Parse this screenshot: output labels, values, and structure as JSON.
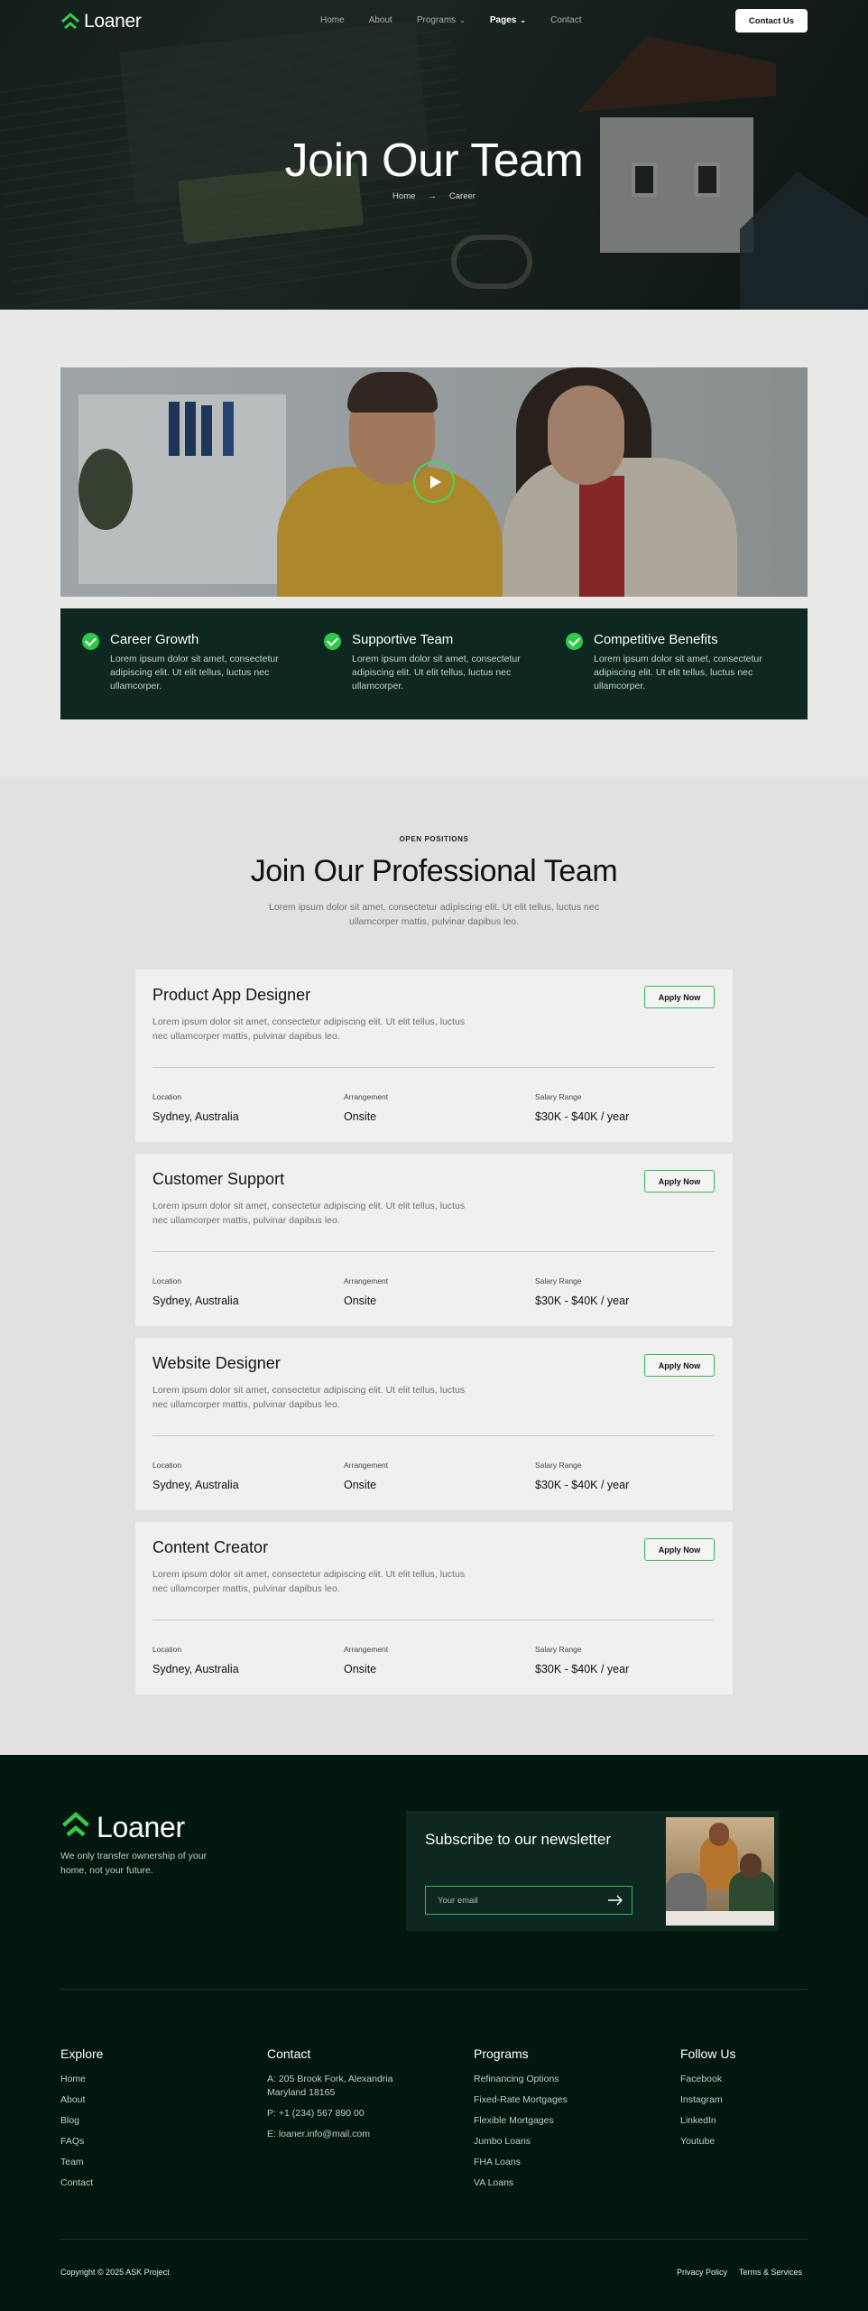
{
  "colors": {
    "accent": "#35b84d",
    "dark_green": "#0c2820",
    "footer_bg": "#04170f",
    "page_bg": "#e9e9e8"
  },
  "brand": {
    "name": "Loaner",
    "icon": "house-arrow-icon"
  },
  "nav": {
    "items": [
      {
        "label": "Home",
        "dropdown": false
      },
      {
        "label": "About",
        "dropdown": false
      },
      {
        "label": "Programs",
        "dropdown": true
      },
      {
        "label": "Pages",
        "dropdown": true,
        "active": true
      },
      {
        "label": "Contact",
        "dropdown": false
      }
    ],
    "cta": "Contact Us"
  },
  "hero": {
    "title": "Join Our Team",
    "breadcrumb": [
      "Home",
      "Career"
    ],
    "breadcrumb_separator": "→"
  },
  "video": {
    "play_icon": "play-icon"
  },
  "features": [
    {
      "title": "Career Growth",
      "text": "Lorem ipsum dolor sit amet, consectetur adipiscing elit. Ut elit tellus, luctus nec ullamcorper."
    },
    {
      "title": "Supportive Team",
      "text": "Lorem ipsum dolor sit amet, consectetur adipiscing elit. Ut elit tellus, luctus nec ullamcorper."
    },
    {
      "title": "Competitive Benefits",
      "text": "Lorem ipsum dolor sit amet, consectetur adipiscing elit. Ut elit tellus, luctus nec ullamcorper."
    }
  ],
  "positions": {
    "eyebrow": "OPEN POSITIONS",
    "title": "Join Our Professional Team",
    "description": "Lorem ipsum dolor sit amet, consectetur adipiscing elit. Ut elit tellus, luctus nec ullamcorper mattis, pulvinar dapibus leo.",
    "apply_label": "Apply Now",
    "labels": {
      "location": "Location",
      "arrangement": "Arrangement",
      "salary": "Salary Range"
    },
    "jobs": [
      {
        "title": "Product App Designer",
        "description": "Lorem ipsum dolor sit amet, consectetur adipiscing elit. Ut elit tellus, luctus nec ullamcorper mattis, pulvinar dapibus leo.",
        "location": "Sydney, Australia",
        "arrangement": "Onsite",
        "salary": "$30K - $40K / year"
      },
      {
        "title": "Customer Support",
        "description": "Lorem ipsum dolor sit amet, consectetur adipiscing elit. Ut elit tellus, luctus nec ullamcorper mattis, pulvinar dapibus leo.",
        "location": "Sydney, Australia",
        "arrangement": "Onsite",
        "salary": "$30K - $40K / year"
      },
      {
        "title": "Website Designer",
        "description": "Lorem ipsum dolor sit amet, consectetur adipiscing elit. Ut elit tellus, luctus nec ullamcorper mattis, pulvinar dapibus leo.",
        "location": "Sydney, Australia",
        "arrangement": "Onsite",
        "salary": "$30K - $40K / year"
      },
      {
        "title": "Content Creator",
        "description": "Lorem ipsum dolor sit amet, consectetur adipiscing elit. Ut elit tellus, luctus nec ullamcorper mattis, pulvinar dapibus leo.",
        "location": "Sydney, Australia",
        "arrangement": "Onsite",
        "salary": "$30K - $40K / year"
      }
    ]
  },
  "footer": {
    "tagline": "We only transfer ownership of your home, not your future.",
    "newsletter": {
      "title": "Subscribe to our newsletter",
      "placeholder": "Your email",
      "send_icon": "arrow-right-icon"
    },
    "columns": [
      {
        "title": "Explore",
        "links": [
          "Home",
          "About",
          "Blog",
          "FAQs",
          "Team",
          "Contact"
        ]
      },
      {
        "title": "Contact",
        "links": [
          "A: 205 Brook Fork, Alexandria Maryland 18165",
          "P: +1 (234) 567 890 00",
          "E: loaner.info@mail.com"
        ]
      },
      {
        "title": "Programs",
        "links": [
          "Refinancing Options",
          "Fixed-Rate Mortgages",
          "Flexible Mortgages",
          "Jumbo Loans",
          "FHA Loans",
          "VA Loans"
        ]
      },
      {
        "title": "Follow Us",
        "links": [
          "Facebook",
          "Instagram",
          "LinkedIn",
          "Youtube"
        ]
      }
    ],
    "copyright": "Copyright © 2025 ASK Project",
    "legal": [
      "Privacy Policy",
      "Terms & Services"
    ]
  }
}
